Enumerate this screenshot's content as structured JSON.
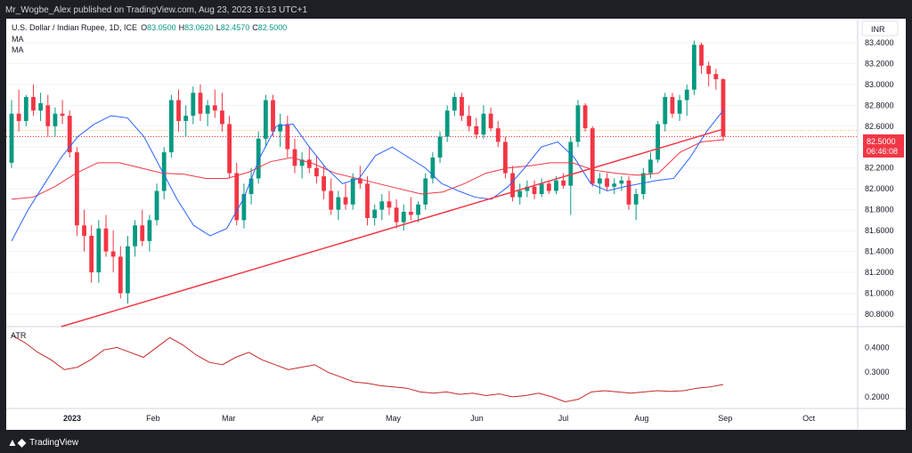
{
  "header": {
    "publish_line": "Mr_Wogbe_Alex published on TradingView.com, Aug 23, 2023 16:13 UTC+1"
  },
  "legend": {
    "symbol": "U.S. Dollar / Indian Rupee, 1D, ICE",
    "o_label": "O",
    "o_value": "83.0500",
    "h_label": "H",
    "h_value": "83.0620",
    "l_label": "L",
    "l_value": "82.4570",
    "c_label": "C",
    "c_value": "82.5000",
    "ma1": "MA",
    "ma2": "MA"
  },
  "currency": "INR",
  "price_tag": {
    "value": "82.5000",
    "countdown": "06:46:08"
  },
  "indicator": {
    "name": "ATR"
  },
  "footer": {
    "brand": "TradingView"
  },
  "colors": {
    "up": "#089981",
    "down": "#f23645",
    "ma_fast": "#2962ff",
    "ma_slow": "#f23645",
    "trendline": "#f23645",
    "atr": "#c62828"
  },
  "chart_data": {
    "type": "candlestick",
    "y_axis": {
      "ticks": [
        "83.4000",
        "83.2000",
        "83.0000",
        "82.8000",
        "82.6000",
        "82.4000",
        "82.2000",
        "82.0000",
        "81.8000",
        "81.6000",
        "81.4000",
        "81.2000",
        "81.0000",
        "80.8000"
      ],
      "ylim": [
        80.68,
        83.63
      ]
    },
    "x_axis": {
      "labels": [
        {
          "label": "2023",
          "date": "2023-01-02"
        },
        {
          "label": "Feb",
          "date": "2023-02-01"
        },
        {
          "label": "Mar",
          "date": "2023-03-01"
        },
        {
          "label": "Apr",
          "date": "2023-04-03"
        },
        {
          "label": "May",
          "date": "2023-05-01"
        },
        {
          "label": "Jun",
          "date": "2023-06-01"
        },
        {
          "label": "Jul",
          "date": "2023-07-03"
        },
        {
          "label": "Aug",
          "date": "2023-08-01"
        },
        {
          "label": "Sep",
          "date": "2023-09-01"
        },
        {
          "label": "Oct",
          "date": "2023-10-02"
        }
      ]
    },
    "candles": [
      [
        82.25,
        82.85,
        82.2,
        82.72
      ],
      [
        82.72,
        82.95,
        82.55,
        82.65
      ],
      [
        82.65,
        82.9,
        82.6,
        82.88
      ],
      [
        82.88,
        83.0,
        82.7,
        82.75
      ],
      [
        82.75,
        82.92,
        82.65,
        82.82
      ],
      [
        82.8,
        82.9,
        82.5,
        82.6
      ],
      [
        82.6,
        82.78,
        82.5,
        82.72
      ],
      [
        82.72,
        82.85,
        82.62,
        82.7
      ],
      [
        82.7,
        82.75,
        82.3,
        82.35
      ],
      [
        82.35,
        82.4,
        81.55,
        81.65
      ],
      [
        81.65,
        81.8,
        81.4,
        81.55
      ],
      [
        81.55,
        81.65,
        81.1,
        81.2
      ],
      [
        81.2,
        81.7,
        81.1,
        81.62
      ],
      [
        81.62,
        81.75,
        81.35,
        81.4
      ],
      [
        81.4,
        81.6,
        81.2,
        81.35
      ],
      [
        81.35,
        81.45,
        80.95,
        81.0
      ],
      [
        81.0,
        81.55,
        80.9,
        81.45
      ],
      [
        81.45,
        81.7,
        81.35,
        81.65
      ],
      [
        81.65,
        81.8,
        81.45,
        81.5
      ],
      [
        81.5,
        81.75,
        81.4,
        81.7
      ],
      [
        81.7,
        82.05,
        81.65,
        81.98
      ],
      [
        81.98,
        82.4,
        81.9,
        82.35
      ],
      [
        82.35,
        82.9,
        82.3,
        82.85
      ],
      [
        82.85,
        82.95,
        82.55,
        82.65
      ],
      [
        82.65,
        82.8,
        82.5,
        82.7
      ],
      [
        82.7,
        82.98,
        82.62,
        82.92
      ],
      [
        82.92,
        83.0,
        82.65,
        82.72
      ],
      [
        82.72,
        82.85,
        82.6,
        82.8
      ],
      [
        82.8,
        82.95,
        82.68,
        82.75
      ],
      [
        82.75,
        82.92,
        82.55,
        82.62
      ],
      [
        82.62,
        82.7,
        82.1,
        82.15
      ],
      [
        82.15,
        82.25,
        81.65,
        81.7
      ],
      [
        81.7,
        82.05,
        81.62,
        81.95
      ],
      [
        81.95,
        82.2,
        81.85,
        82.1
      ],
      [
        82.1,
        82.55,
        82.05,
        82.48
      ],
      [
        82.48,
        82.9,
        82.4,
        82.85
      ],
      [
        82.85,
        82.9,
        82.5,
        82.55
      ],
      [
        82.55,
        82.72,
        82.4,
        82.62
      ],
      [
        82.62,
        82.7,
        82.3,
        82.38
      ],
      [
        82.38,
        82.48,
        82.15,
        82.22
      ],
      [
        82.22,
        82.35,
        82.1,
        82.28
      ],
      [
        82.28,
        82.4,
        82.15,
        82.2
      ],
      [
        82.2,
        82.32,
        82.05,
        82.12
      ],
      [
        82.12,
        82.22,
        81.9,
        81.98
      ],
      [
        81.98,
        82.1,
        81.75,
        81.8
      ],
      [
        81.8,
        81.98,
        81.7,
        81.92
      ],
      [
        81.92,
        82.05,
        81.8,
        81.85
      ],
      [
        81.85,
        82.15,
        81.8,
        82.1
      ],
      [
        82.1,
        82.22,
        82.0,
        82.05
      ],
      [
        82.05,
        82.12,
        81.65,
        81.72
      ],
      [
        81.72,
        81.85,
        81.65,
        81.8
      ],
      [
        81.8,
        81.95,
        81.7,
        81.88
      ],
      [
        81.88,
        81.98,
        81.75,
        81.82
      ],
      [
        81.82,
        81.9,
        81.62,
        81.68
      ],
      [
        81.68,
        81.85,
        81.6,
        81.78
      ],
      [
        81.78,
        81.92,
        81.7,
        81.75
      ],
      [
        81.75,
        81.88,
        81.68,
        81.85
      ],
      [
        81.85,
        82.15,
        81.8,
        82.1
      ],
      [
        82.1,
        82.35,
        82.05,
        82.3
      ],
      [
        82.3,
        82.55,
        82.25,
        82.5
      ],
      [
        82.5,
        82.8,
        82.45,
        82.75
      ],
      [
        82.75,
        82.92,
        82.7,
        82.88
      ],
      [
        82.88,
        82.92,
        82.65,
        82.7
      ],
      [
        82.7,
        82.8,
        82.55,
        82.6
      ],
      [
        82.6,
        82.68,
        82.48,
        82.52
      ],
      [
        82.52,
        82.8,
        82.48,
        82.72
      ],
      [
        82.72,
        82.78,
        82.55,
        82.58
      ],
      [
        82.58,
        82.65,
        82.4,
        82.45
      ],
      [
        82.45,
        82.5,
        82.1,
        82.15
      ],
      [
        82.15,
        82.22,
        81.88,
        81.92
      ],
      [
        81.92,
        82.05,
        81.85,
        81.98
      ],
      [
        81.98,
        82.08,
        81.92,
        82.02
      ],
      [
        82.02,
        82.08,
        81.9,
        81.95
      ],
      [
        81.95,
        82.1,
        81.92,
        82.05
      ],
      [
        82.05,
        82.08,
        81.95,
        81.98
      ],
      [
        81.98,
        82.12,
        81.95,
        82.08
      ],
      [
        82.08,
        82.15,
        82.0,
        82.03
      ],
      [
        82.03,
        82.5,
        81.75,
        82.45
      ],
      [
        82.45,
        82.85,
        82.4,
        82.8
      ],
      [
        82.8,
        82.82,
        82.55,
        82.58
      ],
      [
        82.58,
        82.6,
        82.02,
        82.05
      ],
      [
        82.05,
        82.15,
        81.95,
        82.1
      ],
      [
        82.1,
        82.15,
        81.98,
        82.02
      ],
      [
        82.02,
        82.1,
        81.95,
        82.05
      ],
      [
        82.05,
        82.12,
        81.98,
        82.08
      ],
      [
        82.08,
        82.12,
        81.8,
        81.85
      ],
      [
        81.85,
        82.0,
        81.7,
        81.95
      ],
      [
        81.95,
        82.2,
        81.9,
        82.15
      ],
      [
        82.15,
        82.35,
        82.1,
        82.28
      ],
      [
        82.28,
        82.65,
        82.25,
        82.62
      ],
      [
        82.62,
        82.92,
        82.55,
        82.88
      ],
      [
        82.88,
        82.92,
        82.68,
        82.72
      ],
      [
        82.72,
        82.9,
        82.65,
        82.85
      ],
      [
        82.85,
        83.0,
        82.7,
        82.95
      ],
      [
        82.95,
        83.42,
        82.9,
        83.38
      ],
      [
        83.38,
        83.4,
        83.1,
        83.18
      ],
      [
        83.18,
        83.22,
        82.98,
        83.1
      ],
      [
        83.1,
        83.15,
        82.95,
        83.05
      ],
      [
        83.05,
        83.06,
        82.46,
        82.5
      ]
    ],
    "ma_fast": [
      81.5,
      81.8,
      82.05,
      82.3,
      82.5,
      82.62,
      82.7,
      82.68,
      82.5,
      82.2,
      81.9,
      81.65,
      81.55,
      81.62,
      81.9,
      82.3,
      82.6,
      82.62,
      82.4,
      82.2,
      82.05,
      82.1,
      82.32,
      82.4,
      82.3,
      82.2,
      82.05,
      81.98,
      81.92,
      81.9,
      82.02,
      82.2,
      82.4,
      82.45,
      82.3,
      82.05,
      81.98,
      82.02,
      82.05,
      82.08,
      82.1,
      82.3,
      82.55,
      82.75
    ],
    "ma_slow": [
      81.9,
      81.92,
      82.02,
      82.15,
      82.25,
      82.25,
      82.2,
      82.15,
      82.14,
      82.1,
      82.1,
      82.16,
      82.26,
      82.3,
      82.24,
      82.15,
      82.1,
      82.05,
      82.0,
      81.95,
      81.97,
      82.05,
      82.15,
      82.2,
      82.22,
      82.25,
      82.25,
      82.18,
      82.15,
      82.13,
      82.15,
      82.35,
      82.45,
      82.47
    ],
    "trendline": {
      "from": {
        "date": "2022-12-29",
        "price": 80.68
      },
      "to": {
        "date": "2023-08-31",
        "price": 82.57
      }
    },
    "atr": {
      "ticks": [
        "0.4000",
        "0.3000",
        "0.2000"
      ],
      "ylim": [
        0.16,
        0.47
      ],
      "values": [
        0.45,
        0.42,
        0.38,
        0.35,
        0.31,
        0.32,
        0.35,
        0.39,
        0.4,
        0.38,
        0.36,
        0.4,
        0.44,
        0.41,
        0.37,
        0.34,
        0.33,
        0.36,
        0.38,
        0.35,
        0.33,
        0.31,
        0.32,
        0.33,
        0.3,
        0.28,
        0.26,
        0.255,
        0.245,
        0.24,
        0.235,
        0.22,
        0.215,
        0.22,
        0.21,
        0.215,
        0.205,
        0.212,
        0.2,
        0.205,
        0.215,
        0.2,
        0.18,
        0.19,
        0.22,
        0.225,
        0.22,
        0.215,
        0.22,
        0.225,
        0.222,
        0.225,
        0.235,
        0.24,
        0.25
      ]
    }
  }
}
